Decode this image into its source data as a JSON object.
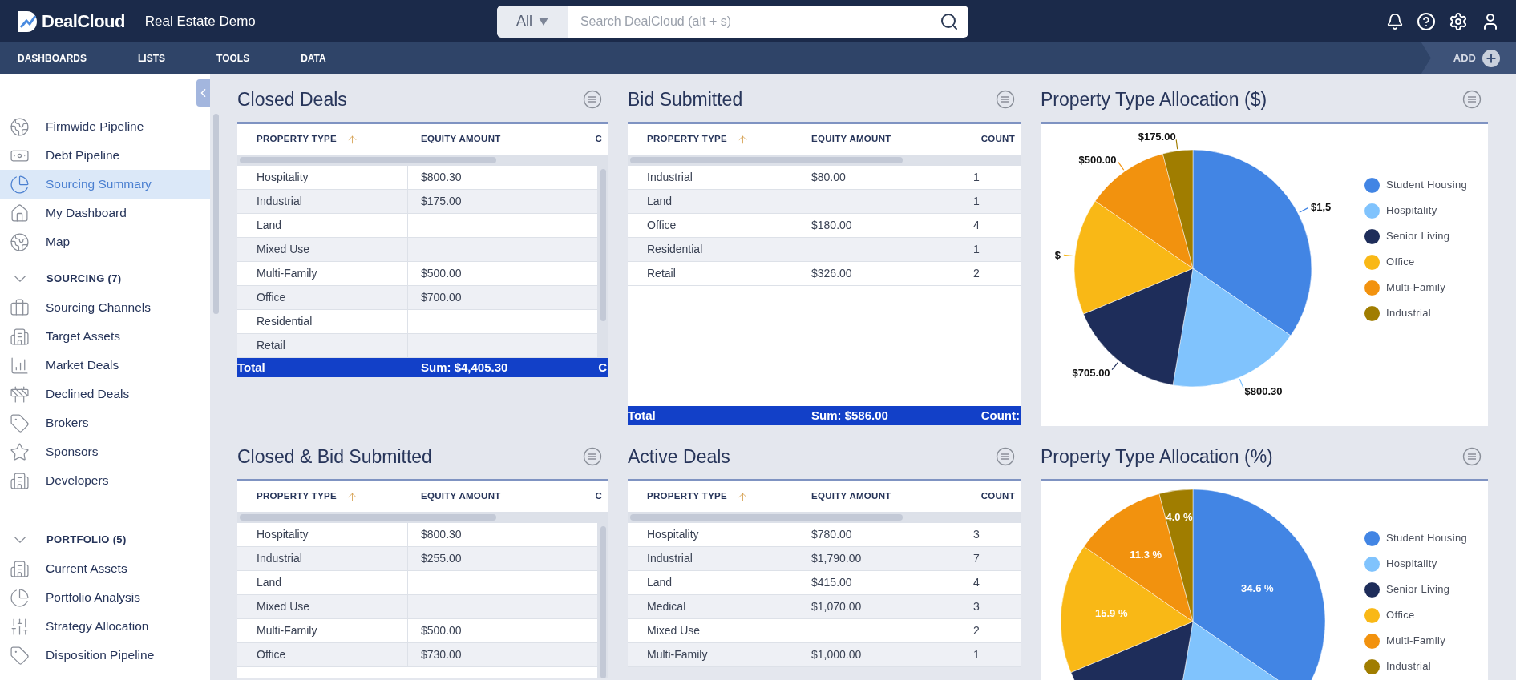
{
  "header": {
    "logo": "DealCloud",
    "workspace": "Real Estate Demo",
    "search": {
      "scope": "All",
      "placeholder": "Search DealCloud (alt + s)"
    }
  },
  "nav": {
    "items": [
      "DASHBOARDS",
      "LISTS",
      "TOOLS",
      "DATA"
    ],
    "add": "ADD"
  },
  "sidebar": {
    "items": [
      {
        "kind": "link",
        "label": "Firmwide Pipeline",
        "selected": false
      },
      {
        "kind": "link",
        "label": "Debt Pipeline",
        "selected": false
      },
      {
        "kind": "link",
        "label": "Sourcing Summary",
        "selected": true
      },
      {
        "kind": "link",
        "label": "My Dashboard",
        "selected": false
      },
      {
        "kind": "link",
        "label": "Map",
        "selected": false
      },
      {
        "kind": "section",
        "label": "SOURCING (7)",
        "expanded": true
      },
      {
        "kind": "link",
        "label": "Sourcing Channels",
        "selected": false
      },
      {
        "kind": "link",
        "label": "Target Assets",
        "selected": false
      },
      {
        "kind": "link",
        "label": "Market Deals",
        "selected": false
      },
      {
        "kind": "link",
        "label": "Declined Deals",
        "selected": false
      },
      {
        "kind": "link",
        "label": "Brokers",
        "selected": false
      },
      {
        "kind": "link",
        "label": "Sponsors",
        "selected": false
      },
      {
        "kind": "link",
        "label": "Developers",
        "selected": false
      },
      {
        "kind": "section",
        "label": "PORTFOLIO (5)",
        "expanded": true
      },
      {
        "kind": "link",
        "label": "Current Assets",
        "selected": false
      },
      {
        "kind": "link",
        "label": "Portfolio Analysis",
        "selected": false
      },
      {
        "kind": "link",
        "label": "Strategy Allocation",
        "selected": false
      },
      {
        "kind": "link",
        "label": "Disposition Pipeline",
        "selected": false
      }
    ]
  },
  "panels": [
    {
      "kind": "table",
      "title": "Closed Deals",
      "columns": [
        {
          "label": "PROPERTY TYPE",
          "sorted": true
        },
        {
          "label": "EQUITY AMOUNT",
          "sorted": false
        },
        {
          "label": "C",
          "sorted": false
        }
      ],
      "rows": [
        [
          "Hospitality",
          "$800.30"
        ],
        [
          "Industrial",
          "$175.00"
        ],
        [
          "Land",
          ""
        ],
        [
          "Mixed Use",
          ""
        ],
        [
          "Multi-Family",
          "$500.00"
        ],
        [
          "Office",
          "$700.00"
        ],
        [
          "Residential",
          ""
        ],
        [
          "Retail",
          ""
        ]
      ],
      "total": [
        "Total",
        "Sum: $4,405.30",
        "C"
      ]
    },
    {
      "kind": "table",
      "title": "Bid Submitted",
      "columns": [
        {
          "label": "PROPERTY TYPE",
          "sorted": true
        },
        {
          "label": "EQUITY AMOUNT",
          "sorted": false
        },
        {
          "label": "COUNT",
          "sorted": false
        }
      ],
      "rows": [
        [
          "Industrial",
          "$80.00",
          "1"
        ],
        [
          "Land",
          "",
          "1"
        ],
        [
          "Office",
          "$180.00",
          "4"
        ],
        [
          "Residential",
          "",
          "1"
        ],
        [
          "Retail",
          "$326.00",
          "2"
        ]
      ],
      "total": [
        "Total",
        "Sum: $586.00",
        "Count:"
      ]
    },
    {
      "kind": "pie",
      "title": "Property Type Allocation ($)",
      "labels_inside": false,
      "chart_data": {
        "type": "pie",
        "categories": [
          "Student Housing",
          "Hospitality",
          "Senior Living",
          "Office",
          "Multi-Family",
          "Industrial"
        ],
        "series": [
          {
            "values": [
              34.6,
              18.1,
              16.0,
              15.9,
              11.3,
              4.1
            ]
          }
        ],
        "colors": [
          "#4285e4",
          "#80c3fd",
          "#1e2d5a",
          "#f9b816",
          "#f2920e",
          "#a07d00"
        ],
        "value_labels": [
          "$1,5",
          "$800.30",
          "$705.00",
          "$",
          "$500.00",
          "$175.00"
        ]
      }
    },
    {
      "kind": "table",
      "title": "Closed & Bid Submitted",
      "columns": [
        {
          "label": "PROPERTY TYPE",
          "sorted": true
        },
        {
          "label": "EQUITY AMOUNT",
          "sorted": false
        },
        {
          "label": "C",
          "sorted": false
        }
      ],
      "rows": [
        [
          "Hospitality",
          "$800.30"
        ],
        [
          "Industrial",
          "$255.00"
        ],
        [
          "Land",
          ""
        ],
        [
          "Mixed Use",
          ""
        ],
        [
          "Multi-Family",
          "$500.00"
        ],
        [
          "Office",
          "$730.00"
        ]
      ]
    },
    {
      "kind": "table",
      "title": "Active Deals",
      "columns": [
        {
          "label": "PROPERTY TYPE",
          "sorted": true
        },
        {
          "label": "EQUITY AMOUNT",
          "sorted": false
        },
        {
          "label": "COUNT",
          "sorted": false
        }
      ],
      "rows": [
        [
          "Hospitality",
          "$780.00",
          "3"
        ],
        [
          "Industrial",
          "$1,790.00",
          "7"
        ],
        [
          "Land",
          "$415.00",
          "4"
        ],
        [
          "Medical",
          "$1,070.00",
          "3"
        ],
        [
          "Mixed Use",
          "",
          "2"
        ],
        [
          "Multi-Family",
          "$1,000.00",
          "1"
        ]
      ]
    },
    {
      "kind": "pie",
      "title": "Property Type Allocation (%)",
      "labels_inside": true,
      "chart_data": {
        "type": "pie",
        "categories": [
          "Student Housing",
          "Hospitality",
          "Senior Living",
          "Office",
          "Multi-Family",
          "Industrial"
        ],
        "series": [
          {
            "values": [
              34.6,
              18.1,
              16.0,
              15.9,
              11.3,
              4.1
            ]
          }
        ],
        "colors": [
          "#4285e4",
          "#80c3fd",
          "#1e2d5a",
          "#f9b816",
          "#f2920e",
          "#a07d00"
        ],
        "value_labels": [
          "34.6 %",
          null,
          null,
          "15.9 %",
          "11.3 %",
          "4.0 %"
        ]
      }
    }
  ]
}
